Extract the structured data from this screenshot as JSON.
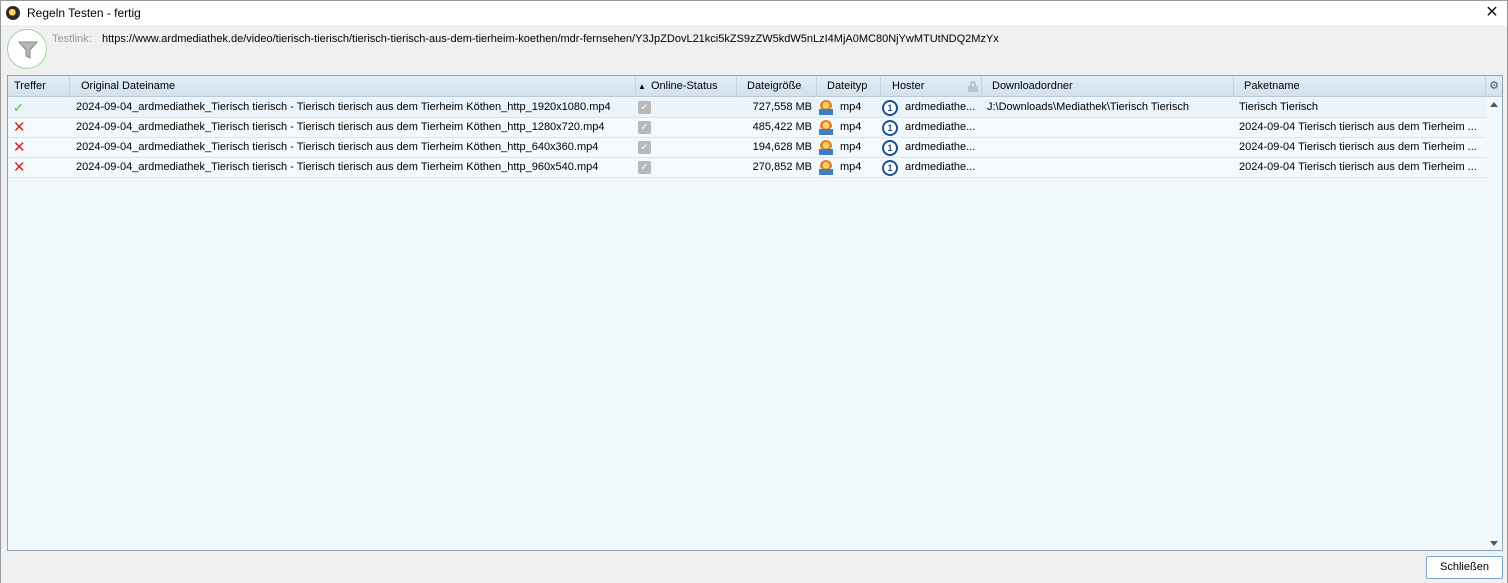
{
  "window": {
    "title": "Regeln Testen - fertig",
    "close_glyph": "✕"
  },
  "header": {
    "testlink_label": "Testlink:",
    "testlink_url": "https://www.ardmediathek.de/video/tierisch-tierisch/tierisch-tierisch-aus-dem-tierheim-koethen/mdr-fernsehen/Y3JpZDovL21kci5kZS9zZW5kdW5nLzI4MjA0MC80NjYwMTUtNDQ2MzYx",
    "icon": "filter-icon"
  },
  "table": {
    "columns": {
      "treffer": "Treffer",
      "original_dateiname": "Original Dateiname",
      "online_status": "Online-Status",
      "dateigroesse": "Dateigröße",
      "dateityp": "Dateityp",
      "hoster": "Hoster",
      "downloadordner": "Downloadordner",
      "paketname": "Paketname"
    },
    "sort_indicator": "▲",
    "rows": [
      {
        "match": "check",
        "match_glyph": "✓",
        "filename": "2024-09-04_ardmediathek_Tierisch tierisch - Tierisch tierisch aus dem Tierheim Köthen_http_1920x1080.mp4",
        "online": "✓",
        "size": "727,558 MB",
        "type": "mp4",
        "hoster": "ardmediathe...",
        "hoster_glyph": "1",
        "downloadfolder": "J:\\Downloads\\Mediathek\\Tierisch Tierisch",
        "package": "Tierisch Tierisch"
      },
      {
        "match": "cross",
        "match_glyph": "✕",
        "filename": "2024-09-04_ardmediathek_Tierisch tierisch - Tierisch tierisch aus dem Tierheim Köthen_http_1280x720.mp4",
        "online": "✓",
        "size": "485,422 MB",
        "type": "mp4",
        "hoster": "ardmediathe...",
        "hoster_glyph": "1",
        "downloadfolder": "",
        "package": "2024-09-04 Tierisch tierisch aus dem Tierheim ..."
      },
      {
        "match": "cross",
        "match_glyph": "✕",
        "filename": "2024-09-04_ardmediathek_Tierisch tierisch - Tierisch tierisch aus dem Tierheim Köthen_http_640x360.mp4",
        "online": "✓",
        "size": "194,628 MB",
        "type": "mp4",
        "hoster": "ardmediathe...",
        "hoster_glyph": "1",
        "downloadfolder": "",
        "package": "2024-09-04 Tierisch tierisch aus dem Tierheim ..."
      },
      {
        "match": "cross",
        "match_glyph": "✕",
        "filename": "2024-09-04_ardmediathek_Tierisch tierisch - Tierisch tierisch aus dem Tierheim Köthen_http_960x540.mp4",
        "online": "✓",
        "size": "270,852 MB",
        "type": "mp4",
        "hoster": "ardmediathe...",
        "hoster_glyph": "1",
        "downloadfolder": "",
        "package": "2024-09-04 Tierisch tierisch aus dem Tierheim ..."
      }
    ],
    "settings_glyph": "⚙"
  },
  "footer": {
    "close_label": "Schließen"
  },
  "colors": {
    "match_ok": "#5bb04a",
    "match_fail": "#dd2222",
    "grid_bg": "#f0f8fb",
    "header_bg": "#d8e6f2",
    "button_border": "#7aa4d0"
  }
}
